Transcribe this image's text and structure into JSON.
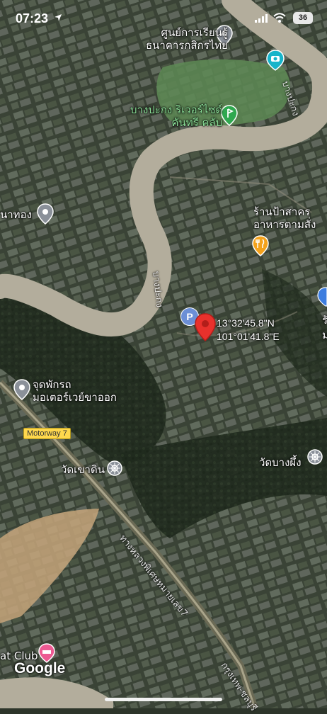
{
  "status_bar": {
    "time": "07:23",
    "battery": "36"
  },
  "map": {
    "places": {
      "learning_center": [
        "ศูนย์การเรียนรู้",
        "ธนาคารกสิกรไทย"
      ],
      "golf_club": [
        "บางปะกง ริเวอร์ไซด์",
        "คันทรี คลับ"
      ],
      "river_east": "บางปะกง",
      "village_west": "นาทอง",
      "restaurant": [
        "ร้านป้าสาคร",
        "อาหารตามสั่ง"
      ],
      "river_center": "บางปะกง",
      "rest_area": [
        "จุดพักรถ",
        "มอเตอร์เวย์ขาออก"
      ],
      "temple_khao_din": "วัดเขาดิน",
      "temple_bang_phueng": "วัดบางผึ้ง",
      "highway_label": "ทางหลวงพิเศษหมายเลข7",
      "highway_label_2": "กรุงเทพ-ชลบุรี",
      "boat_club": "at Club",
      "edge_label_1": "รั",
      "edge_label_2": "ม"
    },
    "dropped_pin": {
      "lat": "13°32'45.8\"N",
      "lng": "101°01'41.8\"E"
    },
    "motorway_shield": "Motorway 7",
    "parking_symbol": "P",
    "attribution": "Google",
    "icons": [
      "location-arrow-icon",
      "signal-icon",
      "wifi-icon",
      "battery-icon",
      "pin-icon",
      "camera-icon",
      "golf-icon",
      "fork-knife-icon",
      "temple-icon",
      "parking-icon",
      "hotel-icon",
      "info-icon"
    ],
    "colors": {
      "river": "#b3ad9c",
      "red_pin": "#e8312c",
      "green_label": "#8ee39a",
      "orange_pin": "#f4a21c",
      "grey_pin": "#8a9099",
      "teal_pin": "#17b4c9",
      "motorway": "#ffd84d",
      "pink_pin": "#ec5a92"
    }
  }
}
